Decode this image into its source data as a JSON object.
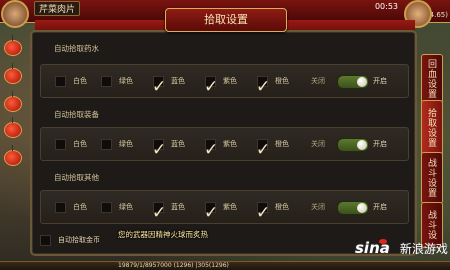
{
  "header": {
    "player_name": "芹菜肉片",
    "clock": "00:53",
    "signal": "",
    "level_right": "(4.65)"
  },
  "title": "拾取设置",
  "sections": [
    {
      "label": "自动拾取药水",
      "options": [
        {
          "label": "白色",
          "checked": false
        },
        {
          "label": "绿色",
          "checked": false
        },
        {
          "label": "蓝色",
          "checked": true
        },
        {
          "label": "紫色",
          "checked": true
        },
        {
          "label": "橙色",
          "checked": true
        }
      ],
      "toggle": {
        "off_label": "关闭",
        "on_label": "开启",
        "state": "on"
      }
    },
    {
      "label": "自动拾取装备",
      "options": [
        {
          "label": "白色",
          "checked": false
        },
        {
          "label": "绿色",
          "checked": false
        },
        {
          "label": "蓝色",
          "checked": true
        },
        {
          "label": "紫色",
          "checked": true
        },
        {
          "label": "橙色",
          "checked": true
        }
      ],
      "toggle": {
        "off_label": "关闭",
        "on_label": "开启",
        "state": "on"
      }
    },
    {
      "label": "自动拾取其他",
      "options": [
        {
          "label": "白色",
          "checked": false
        },
        {
          "label": "绿色",
          "checked": false
        },
        {
          "label": "蓝色",
          "checked": true
        },
        {
          "label": "紫色",
          "checked": true
        },
        {
          "label": "橙色",
          "checked": true
        }
      ],
      "toggle": {
        "off_label": "关闭",
        "on_label": "开启",
        "state": "on"
      }
    }
  ],
  "gold": {
    "label": "自动拾取金币",
    "checked": false
  },
  "right_tabs": [
    {
      "label": "回血设置",
      "active": false
    },
    {
      "label": "拾取设置",
      "active": true
    },
    {
      "label": "战斗设置",
      "active": false
    },
    {
      "label": "战斗设",
      "active": false
    }
  ],
  "system_message": "您的武器因精神火球而炙热",
  "bottom": {
    "exp_text": "19879/1/8957000 (1296) |305(1296)"
  },
  "watermark": {
    "brand": "sina",
    "cn": "新浪游戏"
  }
}
